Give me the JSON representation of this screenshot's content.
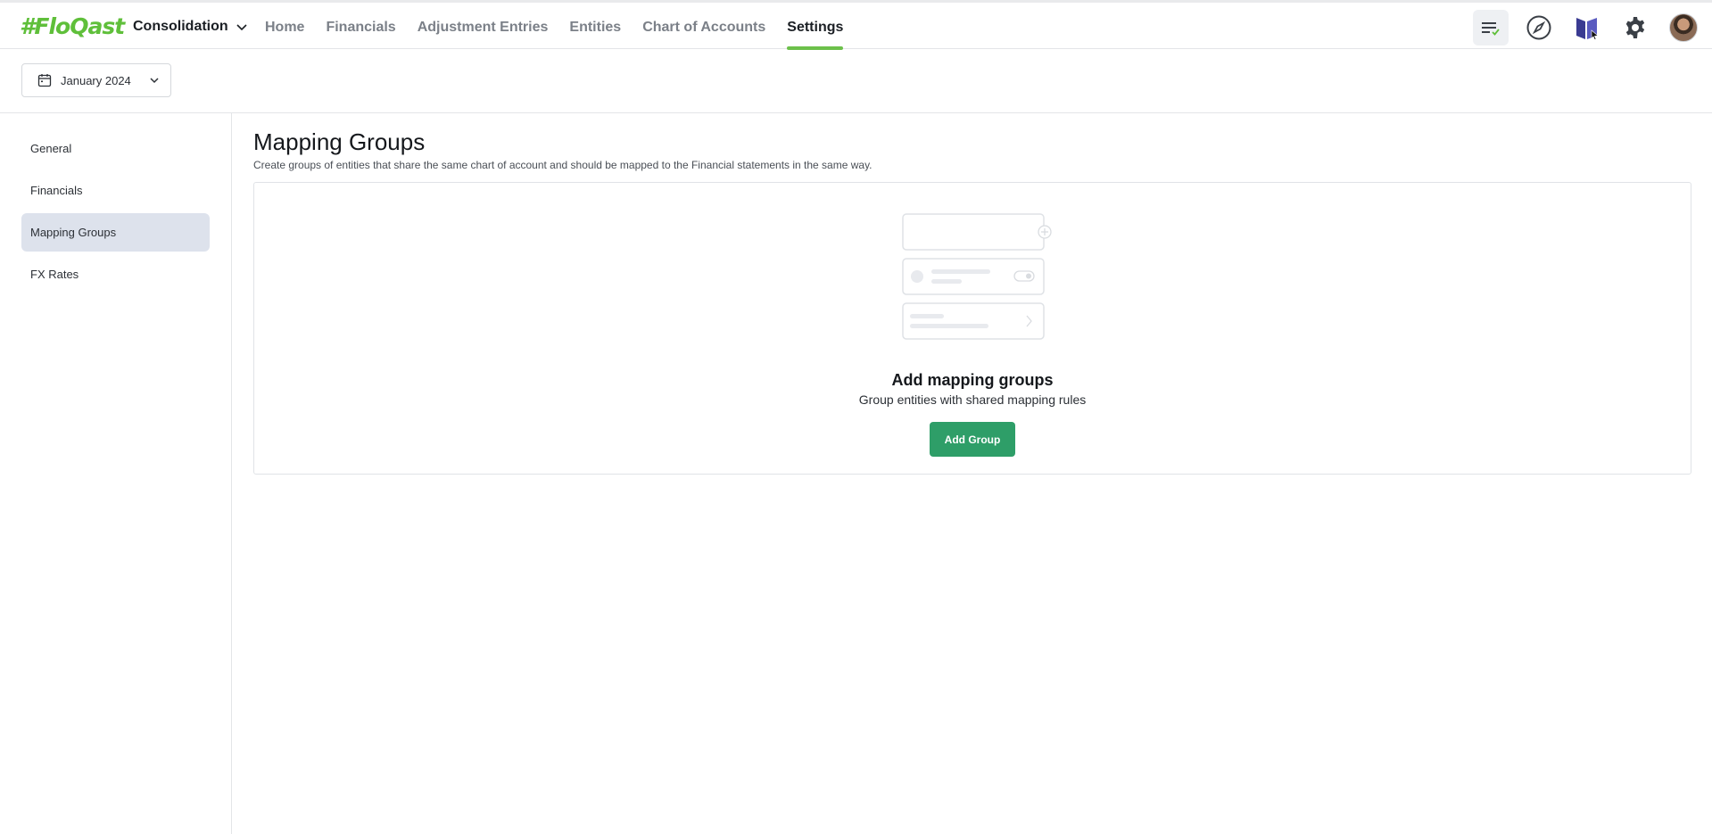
{
  "app": {
    "logo_text": "#FloQast",
    "product_label": "Consolidation"
  },
  "nav": {
    "items": [
      {
        "label": "Home",
        "active": false
      },
      {
        "label": "Financials",
        "active": false
      },
      {
        "label": "Adjustment Entries",
        "active": false
      },
      {
        "label": "Entities",
        "active": false
      },
      {
        "label": "Chart of Accounts",
        "active": false
      },
      {
        "label": "Settings",
        "active": true
      }
    ]
  },
  "top_icons": [
    "tasks-check-icon",
    "compass-icon",
    "book-icon",
    "gear-icon",
    "user-avatar"
  ],
  "period": {
    "label": "January 2024"
  },
  "sidebar": {
    "items": [
      {
        "label": "General",
        "active": false
      },
      {
        "label": "Financials",
        "active": false
      },
      {
        "label": "Mapping Groups",
        "active": true
      },
      {
        "label": "FX Rates",
        "active": false
      }
    ]
  },
  "main": {
    "title": "Mapping Groups",
    "description": "Create groups of entities that share the same chart of account and should be mapped to the Financial statements in the same way.",
    "empty_state": {
      "title": "Add mapping groups",
      "subtitle": "Group entities with shared mapping rules",
      "button_label": "Add Group"
    }
  },
  "colors": {
    "accent_green": "#6cc04a",
    "button_green": "#2e9e68",
    "active_sidebar_bg": "#dde2ec"
  }
}
